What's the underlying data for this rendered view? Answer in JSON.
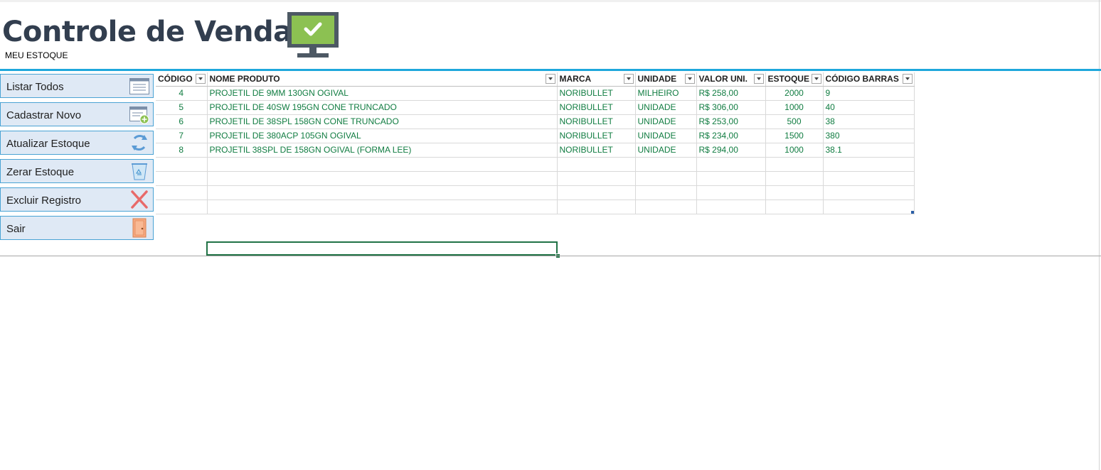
{
  "header": {
    "title": "Controle de Vendas",
    "subtitle": "MEU ESTOQUE",
    "accent_color": "#1fa7dc",
    "logo_icon": "monitor-check-icon"
  },
  "sidebar": {
    "items": [
      {
        "label": "Listar Todos",
        "icon": "list-window-icon"
      },
      {
        "label": "Cadastrar Novo",
        "icon": "add-window-icon"
      },
      {
        "label": "Atualizar Estoque",
        "icon": "refresh-icon"
      },
      {
        "label": "Zerar Estoque",
        "icon": "recycle-bin-icon"
      },
      {
        "label": "Excluir Registro",
        "icon": "red-x-icon"
      },
      {
        "label": "Sair",
        "icon": "door-icon"
      }
    ]
  },
  "table": {
    "columns": [
      "CÓDIGO",
      "NOME PRODUTO",
      "MARCA",
      "UNIDADE",
      "VALOR UNI.",
      "ESTOQUE",
      "CÓDIGO BARRAS"
    ],
    "rows": [
      [
        "4",
        "PROJETIL DE 9MM 130GN OGIVAL",
        "NORIBULLET",
        "MILHEIRO",
        "R$ 258,00",
        "2000",
        "9"
      ],
      [
        "5",
        "PROJETIL DE 40SW 195GN CONE TRUNCADO",
        "NORIBULLET",
        "UNIDADE",
        "R$ 306,00",
        "1000",
        "40"
      ],
      [
        "6",
        "PROJETIL DE 38SPL 158GN CONE TRUNCADO",
        "NORIBULLET",
        "UNIDADE",
        "R$ 253,00",
        "500",
        "38"
      ],
      [
        "7",
        "PROJETIL DE 380ACP 105GN OGIVAL",
        "NORIBULLET",
        "UNIDADE",
        "R$ 234,00",
        "1500",
        "380"
      ],
      [
        "8",
        "PROJETIL 38SPL DE 158GN OGIVAL (FORMA LEE)",
        "NORIBULLET",
        "UNIDADE",
        "R$ 294,00",
        "1000",
        "38.1"
      ],
      [
        "",
        "",
        "",
        "",
        "",
        "",
        ""
      ],
      [
        "",
        "",
        "",
        "",
        "",
        "",
        ""
      ],
      [
        "",
        "",
        "",
        "",
        "",
        "",
        ""
      ],
      [
        "",
        "",
        "",
        "",
        "",
        "",
        ""
      ]
    ],
    "text_color": "#107c41"
  }
}
